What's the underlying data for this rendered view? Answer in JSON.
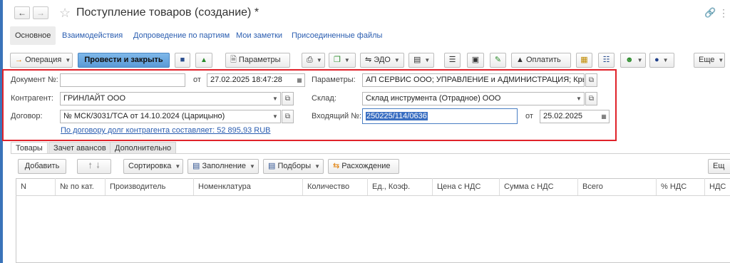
{
  "window": {
    "title": "Поступление товаров (создание) *"
  },
  "top_tabs": [
    {
      "label": "Основное"
    },
    {
      "label": "Взаимодействия"
    },
    {
      "label": "Допроведение по партиям"
    },
    {
      "label": "Мои заметки"
    },
    {
      "label": "Присоединенные файлы"
    }
  ],
  "toolbar": {
    "operation": "Операция",
    "post_close": "Провести и закрыть",
    "parameters": "Параметры",
    "edo": "ЭДО",
    "pay": "Оплатить",
    "more": "Еще"
  },
  "form": {
    "doc_no_label": "Документ №:",
    "doc_no_value": "",
    "from_label": "от",
    "doc_date": "27.02.2025 18:47:28",
    "params_label": "Параметры:",
    "params_value": "АП СЕРВИС ООО; УПРАВЛЕНИЕ и АДМИНИСТРАЦИЯ; Крыст",
    "contractor_label": "Контрагент:",
    "contractor_value": "ГРИНЛАЙТ ООО",
    "warehouse_label": "Склад:",
    "warehouse_value": "Склад инструмента (Отрадное) ООО",
    "contract_label": "Договор:",
    "contract_value": "№ МСК/3031/ТСА от 14.10.2024 (Царицыно)",
    "incoming_label": "Входящий №:",
    "incoming_value": "250225/114/0636",
    "incoming_from_label": "от",
    "incoming_date": "25.02.2025",
    "debt_link": "По договору долг контрагента составляет: 52 895,93 RUB"
  },
  "inner_tabs": [
    {
      "label": "Товары"
    },
    {
      "label": "Зачет авансов"
    },
    {
      "label": "Дополнительно"
    }
  ],
  "table_toolbar": {
    "add": "Добавить",
    "sort": "Сортировка",
    "fill": "Заполнение",
    "picks": "Подборы",
    "diff": "Расхождение",
    "more": "Ещ"
  },
  "table": {
    "columns": [
      "N",
      "№ по кат.",
      "Производитель",
      "Номенклатура",
      "Количество",
      "Ед., Коэф.",
      "Цена с НДС",
      "Сумма с НДС",
      "Всего",
      "% НДС",
      "НДС"
    ]
  },
  "colors": {
    "accent": "#5a9ad6",
    "highlight_box": "#e0222a",
    "link": "#2a5db0"
  }
}
